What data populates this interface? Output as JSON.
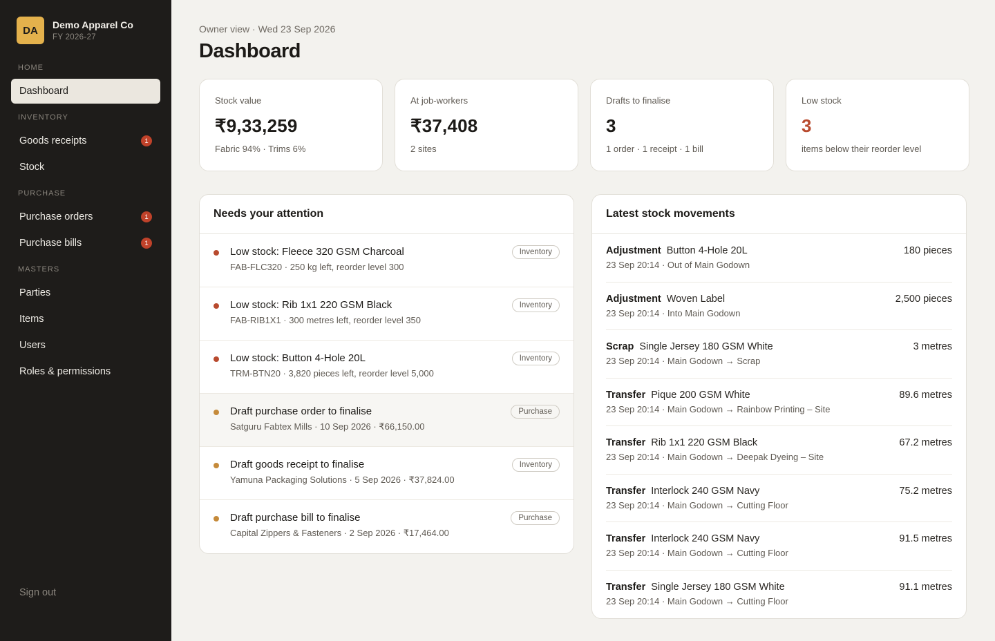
{
  "sidebar": {
    "avatar": "DA",
    "company": "Demo Apparel Co",
    "fy": "FY 2026-27",
    "sections": [
      {
        "title": "HOME",
        "items": [
          {
            "label": "Dashboard",
            "badge": ""
          }
        ]
      },
      {
        "title": "INVENTORY",
        "items": [
          {
            "label": "Goods receipts",
            "badge": "1"
          },
          {
            "label": "Stock",
            "badge": ""
          }
        ]
      },
      {
        "title": "PURCHASE",
        "items": [
          {
            "label": "Purchase orders",
            "badge": "1"
          },
          {
            "label": "Purchase bills",
            "badge": "1"
          }
        ]
      },
      {
        "title": "MASTERS",
        "items": [
          {
            "label": "Parties",
            "badge": ""
          },
          {
            "label": "Items",
            "badge": ""
          },
          {
            "label": "Users",
            "badge": ""
          },
          {
            "label": "Roles & permissions",
            "badge": ""
          }
        ]
      }
    ],
    "sign_out": "Sign out"
  },
  "header": {
    "subtitle": "Owner view · Wed 23 Sep 2026",
    "title": "Dashboard"
  },
  "stats": [
    {
      "label": "Stock value",
      "value": "₹9,33,259",
      "sub": "Fabric 94% · Trims 6%"
    },
    {
      "label": "At job-workers",
      "value": "₹37,408",
      "sub": "2 sites"
    },
    {
      "label": "Drafts to finalise",
      "value": "3",
      "sub": "1 order · 1 receipt · 1 bill"
    },
    {
      "label": "Low stock",
      "value": "3",
      "sub": "items below their reorder level"
    }
  ],
  "attention": {
    "title": "Needs your attention",
    "items": [
      {
        "title": "Low stock: Fleece 320 GSM Charcoal",
        "sub": "FAB-FLC320 · 250 kg left, reorder level 300",
        "tag": "Inventory"
      },
      {
        "title": "Low stock: Rib 1x1 220 GSM Black",
        "sub": "FAB-RIB1X1 · 300 metres left, reorder level 350",
        "tag": "Inventory"
      },
      {
        "title": "Low stock: Button 4-Hole 20L",
        "sub": "TRM-BTN20 · 3,820 pieces left, reorder level 5,000",
        "tag": "Inventory"
      },
      {
        "title": "Draft purchase order to finalise",
        "sub": "Satguru Fabtex Mills · 10 Sep 2026 · ₹66,150.00",
        "tag": "Purchase"
      },
      {
        "title": "Draft goods receipt to finalise",
        "sub": "Yamuna Packaging Solutions · 5 Sep 2026 · ₹37,824.00",
        "tag": "Inventory"
      },
      {
        "title": "Draft purchase bill to finalise",
        "sub": "Capital Zippers & Fasteners · 2 Sep 2026 · ₹17,464.00",
        "tag": "Purchase"
      }
    ]
  },
  "movements": {
    "title": "Latest stock movements",
    "items": [
      {
        "kind": "Adjustment",
        "item": "Button 4-Hole 20L",
        "qty": "180 pieces",
        "time": "23 Sep 20:14",
        "detail": "Out of Main Godown"
      },
      {
        "kind": "Adjustment",
        "item": "Woven Label",
        "qty": "2,500 pieces",
        "time": "23 Sep 20:14",
        "detail": "Into Main Godown"
      },
      {
        "kind": "Scrap",
        "item": "Single Jersey 180 GSM White",
        "qty": "3 metres",
        "time": "23 Sep 20:14",
        "detail": "Main Godown → Scrap"
      },
      {
        "kind": "Transfer",
        "item": "Pique 200 GSM White",
        "qty": "89.6 metres",
        "time": "23 Sep 20:14",
        "detail": "Main Godown → Rainbow Printing – Site"
      },
      {
        "kind": "Transfer",
        "item": "Rib 1x1 220 GSM Black",
        "qty": "67.2 metres",
        "time": "23 Sep 20:14",
        "detail": "Main Godown → Deepak Dyeing – Site"
      },
      {
        "kind": "Transfer",
        "item": "Interlock 240 GSM Navy",
        "qty": "75.2 metres",
        "time": "23 Sep 20:14",
        "detail": "Main Godown → Cutting Floor"
      },
      {
        "kind": "Transfer",
        "item": "Interlock 240 GSM Navy",
        "qty": "91.5 metres",
        "time": "23 Sep 20:14",
        "detail": "Main Godown → Cutting Floor"
      },
      {
        "kind": "Transfer",
        "item": "Single Jersey 180 GSM White",
        "qty": "91.1 metres",
        "time": "23 Sep 20:14",
        "detail": "Main Godown → Cutting Floor"
      }
    ]
  },
  "colors": {
    "sidebar_bg": "#1e1c1a",
    "brand_accent": "#e4b14c",
    "badge": "#c0422a",
    "warn": "#b84a2e",
    "dot_low_stock": "#b84a2e",
    "dot_draft": "#c58a3a"
  }
}
